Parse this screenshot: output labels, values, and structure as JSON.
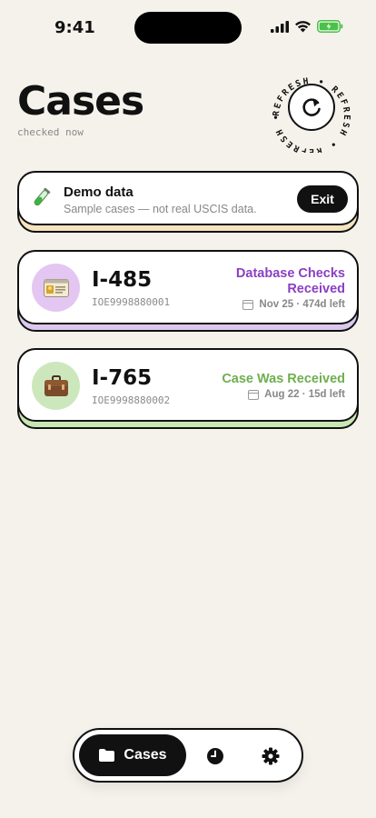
{
  "status_bar": {
    "time": "9:41"
  },
  "header": {
    "title": "Cases",
    "subtitle": "checked now",
    "refresh_ring_text": "REFRESH • REFRESH • REFRESH • REFRESH • "
  },
  "demo_banner": {
    "title": "Demo data",
    "subtitle": "Sample cases — not real USCIS data.",
    "exit_label": "Exit",
    "icon": "test-tube-icon",
    "accent": "#f6e3bf"
  },
  "cases": [
    {
      "form": "I-485",
      "receipt": "IOE9998880001",
      "status_line1": "Database Checks",
      "status_line2": "Received",
      "meta": "Nov 25 · 474d left",
      "status_color": "#8b3fc2",
      "accent": "#dcc8ef",
      "avatar_bg": "#e3c7f2",
      "icon": "id-card-icon"
    },
    {
      "form": "I-765",
      "receipt": "IOE9998880002",
      "status_line1": "Case Was Received",
      "meta": "Aug 22 · 15d left",
      "status_color": "#6fae4e",
      "accent": "#c8e6b4",
      "avatar_bg": "#cde7bd",
      "icon": "briefcase-icon"
    }
  ],
  "tab_bar": {
    "items": [
      {
        "label": "Cases",
        "icon": "folder-icon",
        "active": true
      },
      {
        "label": "",
        "icon": "clock-icon",
        "active": false
      },
      {
        "label": "",
        "icon": "gear-icon",
        "active": false
      }
    ]
  }
}
